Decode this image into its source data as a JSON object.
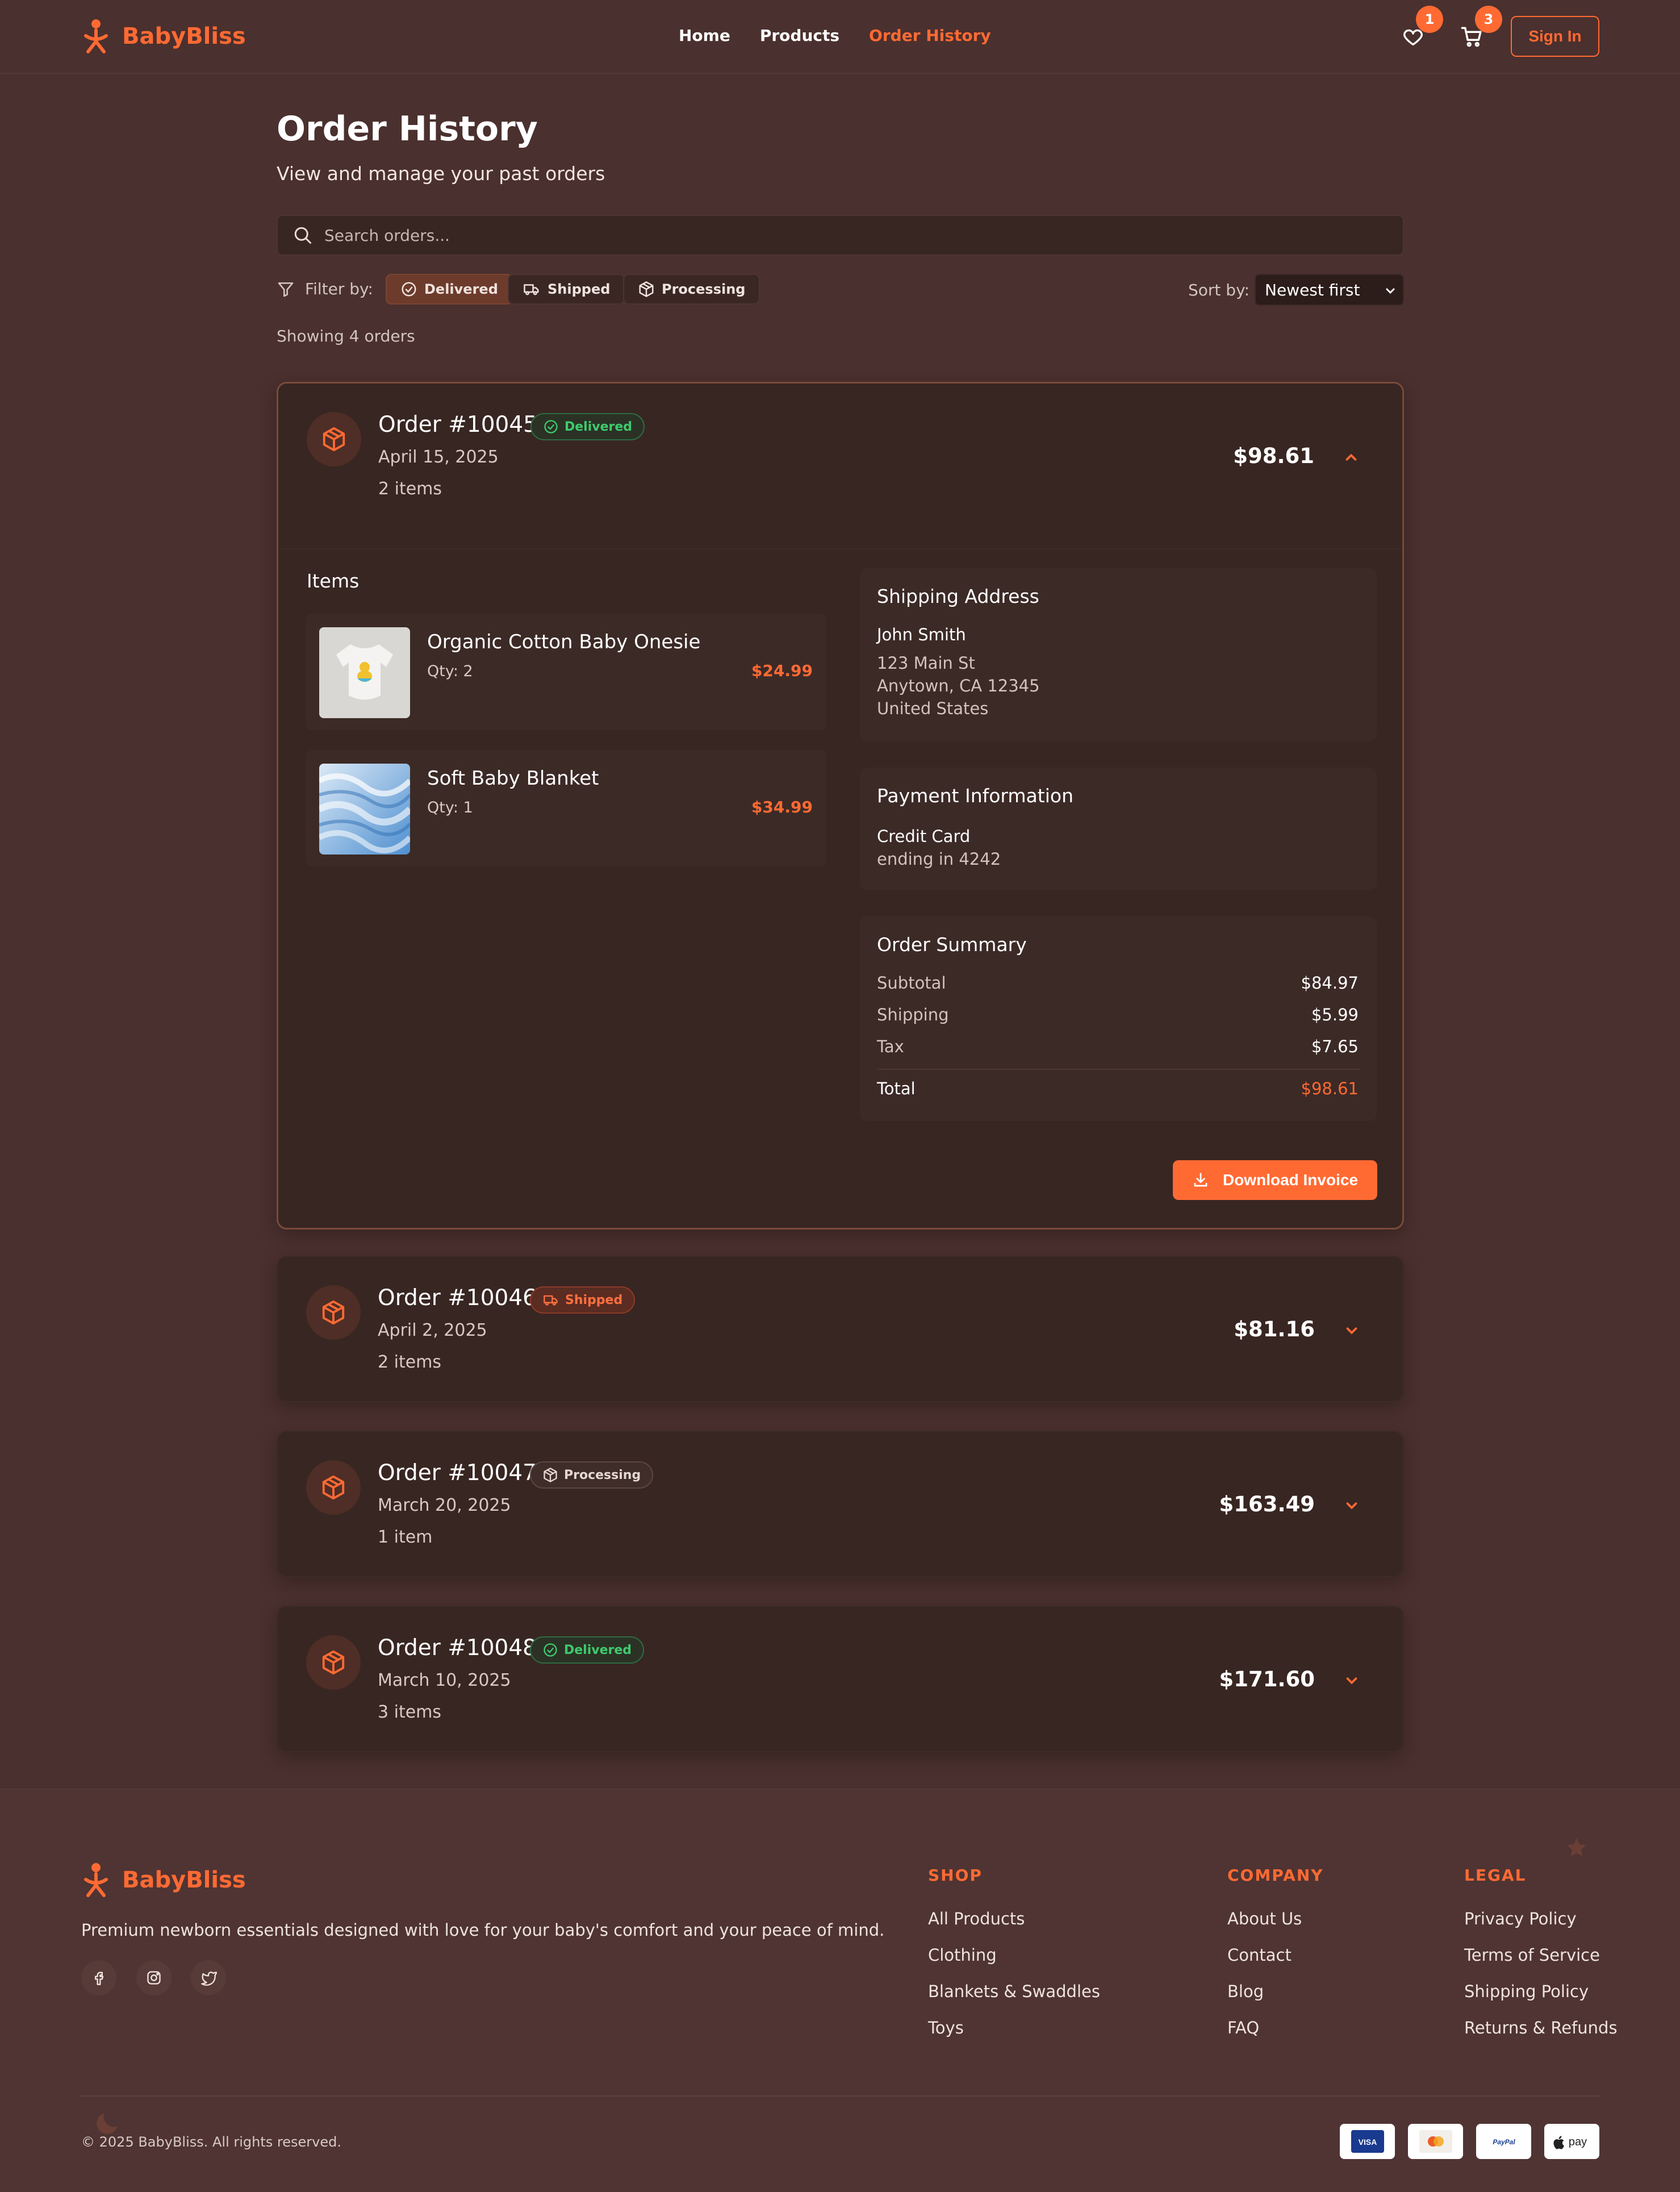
{
  "brand": {
    "name": "BabyBliss"
  },
  "nav": {
    "links": [
      "Home",
      "Products",
      "Order History"
    ],
    "wishlist_count": "1",
    "cart_count": "3",
    "sign_in": "Sign In"
  },
  "header": {
    "title": "Order History",
    "subtitle": "View and manage your past orders"
  },
  "search": {
    "placeholder": "Search orders..."
  },
  "filters": {
    "label": "Filter by:",
    "chips": [
      "Delivered",
      "Shipped",
      "Processing"
    ],
    "active": "Delivered",
    "sort_label": "Sort by:",
    "sort_value": "Newest first"
  },
  "showing": "Showing 4 orders",
  "orders": [
    {
      "number": "Order #10045",
      "status": "Delivered",
      "date": "April 15, 2025",
      "count": "2 items",
      "total": "$98.61",
      "expanded": true,
      "items_title": "Items",
      "items": [
        {
          "name": "Organic Cotton Baby Onesie",
          "qty": "Qty: 2",
          "price": "$24.99"
        },
        {
          "name": "Soft Baby Blanket",
          "qty": "Qty: 1",
          "price": "$34.99"
        }
      ],
      "shipping": {
        "title": "Shipping Address",
        "name": "John Smith",
        "line1": "123 Main St",
        "line2": "Anytown, CA 12345",
        "country": "United States"
      },
      "payment": {
        "title": "Payment Information",
        "method": "Credit Card",
        "detail": "ending in 4242"
      },
      "summary": {
        "title": "Order Summary",
        "rows": [
          {
            "label": "Subtotal",
            "value": "$84.97"
          },
          {
            "label": "Shipping",
            "value": "$5.99"
          },
          {
            "label": "Tax",
            "value": "$7.65"
          }
        ],
        "total_label": "Total",
        "total_value": "$98.61"
      },
      "download": "Download Invoice"
    },
    {
      "number": "Order #10046",
      "status": "Shipped",
      "date": "April 2, 2025",
      "count": "2 items",
      "total": "$81.16",
      "expanded": false
    },
    {
      "number": "Order #10047",
      "status": "Processing",
      "date": "March 20, 2025",
      "count": "1 item",
      "total": "$163.49",
      "expanded": false
    },
    {
      "number": "Order #10048",
      "status": "Delivered",
      "date": "March 10, 2025",
      "count": "3 items",
      "total": "$171.60",
      "expanded": false
    }
  ],
  "footer": {
    "description": "Premium newborn essentials designed with love for your baby's comfort and your peace of mind.",
    "columns": [
      {
        "title": "SHOP",
        "links": [
          "All Products",
          "Clothing",
          "Blankets & Swaddles",
          "Toys"
        ]
      },
      {
        "title": "COMPANY",
        "links": [
          "About Us",
          "Contact",
          "Blog",
          "FAQ"
        ]
      },
      {
        "title": "LEGAL",
        "links": [
          "Privacy Policy",
          "Terms of Service",
          "Shipping Policy",
          "Returns & Refunds"
        ]
      }
    ],
    "copyright": "© 2025 BabyBliss. All rights reserved.",
    "payments": [
      "VISA",
      "mastercard",
      "PayPal",
      "pay"
    ]
  },
  "colors": {
    "accent": "#ff6a33",
    "background": "#4a302e",
    "card": "#382622",
    "delivered": "#3fca6e"
  },
  "icons": [
    "logo-baby-icon",
    "heart-icon",
    "cart-icon",
    "search-icon",
    "filter-icon",
    "check-circle-icon",
    "truck-icon",
    "box-icon",
    "chevron-up-icon",
    "chevron-down-icon",
    "download-icon",
    "facebook-icon",
    "instagram-icon",
    "twitter-icon"
  ]
}
